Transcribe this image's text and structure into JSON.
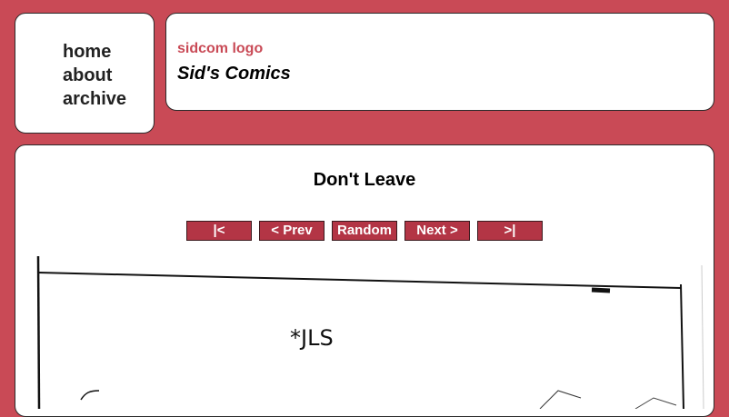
{
  "nav": {
    "items": [
      {
        "label": "home"
      },
      {
        "label": "about"
      },
      {
        "label": "archive"
      }
    ]
  },
  "header": {
    "logo_alt": "sidcom logo",
    "title": "Sid's Comics"
  },
  "comic": {
    "title": "Don't Leave",
    "nav": {
      "first": "|<",
      "prev": "< Prev",
      "random": "Random",
      "next": "Next >",
      "last": ">|"
    },
    "image": {
      "text": "*JLS"
    }
  },
  "colors": {
    "background": "#c94a56",
    "button": "#b33545",
    "logo_text": "#c94a56"
  }
}
